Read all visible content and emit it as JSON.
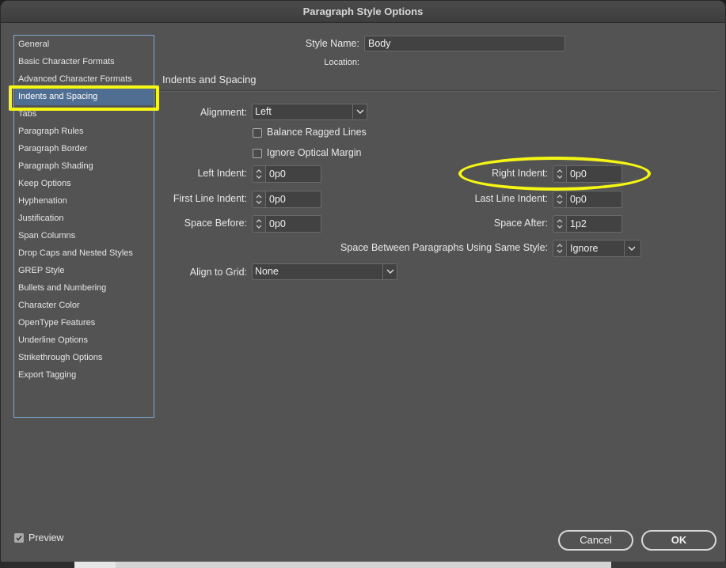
{
  "window": {
    "title": "Paragraph Style Options"
  },
  "sidebar": {
    "items": [
      {
        "label": "General"
      },
      {
        "label": "Basic Character Formats"
      },
      {
        "label": "Advanced Character Formats"
      },
      {
        "label": "Indents and Spacing",
        "selected": true
      },
      {
        "label": "Tabs"
      },
      {
        "label": "Paragraph Rules"
      },
      {
        "label": "Paragraph Border"
      },
      {
        "label": "Paragraph Shading"
      },
      {
        "label": "Keep Options"
      },
      {
        "label": "Hyphenation"
      },
      {
        "label": "Justification"
      },
      {
        "label": "Span Columns"
      },
      {
        "label": "Drop Caps and Nested Styles"
      },
      {
        "label": "GREP Style"
      },
      {
        "label": "Bullets and Numbering"
      },
      {
        "label": "Character Color"
      },
      {
        "label": "OpenType Features"
      },
      {
        "label": "Underline Options"
      },
      {
        "label": "Strikethrough Options"
      },
      {
        "label": "Export Tagging"
      }
    ]
  },
  "header": {
    "style_name_label": "Style Name:",
    "style_name_value": "Body",
    "location_label": "Location:"
  },
  "section": {
    "title": "Indents and Spacing",
    "alignment": {
      "label": "Alignment:",
      "value": "Left"
    },
    "balance_ragged_lines": {
      "label": "Balance Ragged Lines",
      "checked": false
    },
    "ignore_optical_margin": {
      "label": "Ignore Optical Margin",
      "checked": false
    },
    "left_indent": {
      "label": "Left Indent:",
      "value": "0p0"
    },
    "right_indent": {
      "label": "Right Indent:",
      "value": "0p0"
    },
    "first_line_indent": {
      "label": "First Line Indent:",
      "value": "0p0"
    },
    "last_line_indent": {
      "label": "Last Line Indent:",
      "value": "0p0"
    },
    "space_before": {
      "label": "Space Before:",
      "value": "0p0"
    },
    "space_after": {
      "label": "Space After:",
      "value": "1p2"
    },
    "space_between": {
      "label": "Space Between Paragraphs Using Same Style:",
      "value": "Ignore"
    },
    "align_to_grid": {
      "label": "Align to Grid:",
      "value": "None"
    }
  },
  "footer": {
    "preview_label": "Preview",
    "preview_checked": true,
    "cancel_label": "Cancel",
    "ok_label": "OK"
  },
  "colors": {
    "dialog_bg": "#535353",
    "selection": "#4f6e91",
    "sidebar_border": "#7fa8d6",
    "annotation": "#f6f614"
  }
}
